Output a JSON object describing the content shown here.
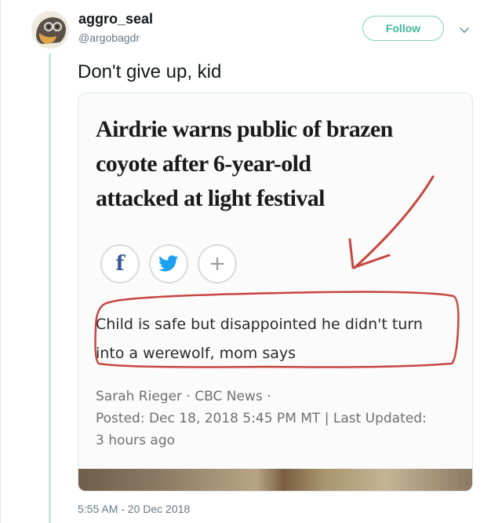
{
  "tweet": {
    "display_name": "aggro_seal",
    "handle": "@argobagdr",
    "follow_label": "Follow",
    "text": "Don't give up, kid",
    "timestamp": "5:55 AM - 20 Dec 2018",
    "accent_color": "#40b89c"
  },
  "article": {
    "headline_lines": [
      "Airdrie warns public of brazen",
      "coyote after 6-year-old",
      "attacked at light festival"
    ],
    "share_icons": [
      "facebook-icon",
      "twitter-icon",
      "plus-icon"
    ],
    "share_glyphs": {
      "facebook": "f",
      "plus": "+"
    },
    "subhead_lines": [
      "Child is safe but disappointed he didn't turn",
      "into a werewolf, mom says"
    ],
    "byline": "Sarah Rieger · CBC News ·",
    "posted": "Posted: Dec 18, 2018 5:45 PM MT | Last Updated:",
    "updated": "3 hours ago",
    "annotation_color": "#c8453f"
  }
}
